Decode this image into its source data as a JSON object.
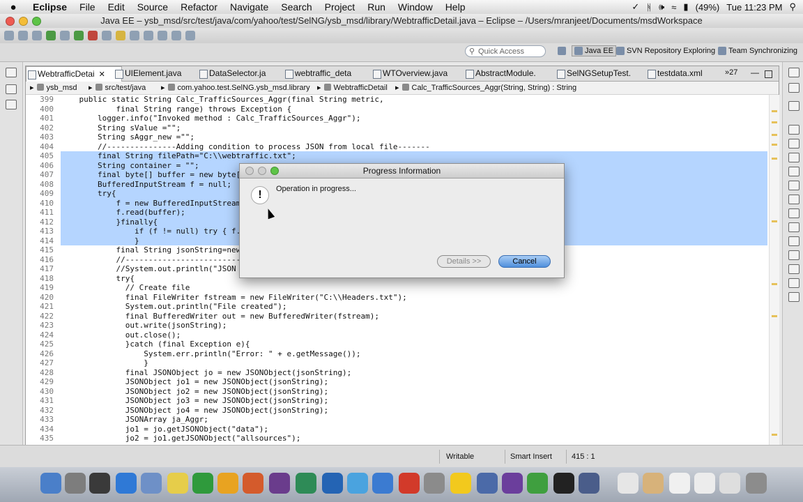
{
  "menubar": {
    "apple": "",
    "app": "Eclipse",
    "items": [
      "File",
      "Edit",
      "Source",
      "Refactor",
      "Navigate",
      "Search",
      "Project",
      "Run",
      "Window",
      "Help"
    ],
    "battery": "(49%)",
    "clock": "Tue 11:23 PM"
  },
  "window": {
    "title": "Java EE – ysb_msd/src/test/java/com/yahoo/test/SelNG/ysb_msd/library/WebtrafficDetail.java – Eclipse – /Users/mranjeet/Documents/msdWorkspace"
  },
  "perspectives": {
    "quick_access_placeholder": "Quick Access",
    "java_ee": "Java EE",
    "svn": "SVN Repository Exploring",
    "team": "Team Synchronizing"
  },
  "tabs": [
    {
      "label": "WebtrafficDetai"
    },
    {
      "label": "UIElement.java"
    },
    {
      "label": "DataSelector.ja"
    },
    {
      "label": "webtraffic_deta"
    },
    {
      "label": "WTOverview.java"
    },
    {
      "label": "AbstractModule."
    },
    {
      "label": "SelNGSetupTest."
    },
    {
      "label": "testdata.xml"
    }
  ],
  "tabs_more": "»27",
  "breadcrumb": [
    "ysb_msd",
    "src/test/java",
    "com.yahoo.test.SelNG.ysb_msd.library",
    "WebtrafficDetail",
    "Calc_TrafficSources_Aggr(String, String) : String"
  ],
  "code": [
    {
      "n": "399",
      "t": "    public static String Calc_TrafficSources_Aggr(final String metric,"
    },
    {
      "n": "400",
      "t": "            final String range) throws Exception {"
    },
    {
      "n": "401",
      "t": "        logger.info(\"Invoked method : Calc_TrafficSources_Aggr\");"
    },
    {
      "n": "402",
      "t": "        String sValue =\"\";"
    },
    {
      "n": "403",
      "t": "        String sAggr_new =\"\";"
    },
    {
      "n": "404",
      "t": "        //---------------Adding condition to process JSON from local file-------"
    },
    {
      "n": "405",
      "t": "        final String filePath=\"C:\\\\webtraffic.txt\";"
    },
    {
      "n": "406",
      "t": "        String container = \"\";"
    },
    {
      "n": "407",
      "t": "        final byte[] buffer = new byte[(i"
    },
    {
      "n": "408",
      "t": "        BufferedInputStream f = null;"
    },
    {
      "n": "409",
      "t": "        try{"
    },
    {
      "n": "410",
      "t": "            f = new BufferedInputStream(n"
    },
    {
      "n": "411",
      "t": "            f.read(buffer);"
    },
    {
      "n": "412",
      "t": "            }finally{"
    },
    {
      "n": "413",
      "t": "                if (f != null) try { f.cl"
    },
    {
      "n": "414",
      "t": "                }"
    },
    {
      "n": "415",
      "t": "            final String jsonString=new S"
    },
    {
      "n": "416",
      "t": "            //----------------------------"
    },
    {
      "n": "417",
      "t": "            //System.out.println(\"JSON Re"
    },
    {
      "n": "418",
      "t": "            try{"
    },
    {
      "n": "419",
      "t": "              // Create file"
    },
    {
      "n": "420",
      "t": "              final FileWriter fstream = new FileWriter(\"C:\\\\Headers.txt\");"
    },
    {
      "n": "421",
      "t": "              System.out.println(\"File created\");"
    },
    {
      "n": "422",
      "t": "              final BufferedWriter out = new BufferedWriter(fstream);"
    },
    {
      "n": "423",
      "t": "              out.write(jsonString);"
    },
    {
      "n": "424",
      "t": "              out.close();"
    },
    {
      "n": "425",
      "t": "              }catch (final Exception e){"
    },
    {
      "n": "426",
      "t": "                  System.err.println(\"Error: \" + e.getMessage());"
    },
    {
      "n": "427",
      "t": "                  }"
    },
    {
      "n": "428",
      "t": "              final JSONObject jo = new JSONObject(jsonString);"
    },
    {
      "n": "429",
      "t": "              JSONObject jo1 = new JSONObject(jsonString);"
    },
    {
      "n": "430",
      "t": "              JSONObject jo2 = new JSONObject(jsonString);"
    },
    {
      "n": "431",
      "t": "              JSONObject jo3 = new JSONObject(jsonString);"
    },
    {
      "n": "432",
      "t": "              JSONObject jo4 = new JSONObject(jsonString);"
    },
    {
      "n": "433",
      "t": "              JSONArray ja_Aggr;"
    },
    {
      "n": "434",
      "t": "              jo1 = jo.getJSONObject(\"data\");"
    },
    {
      "n": "435",
      "t": "              jo2 = jo1.getJSONObject(\"allsources\");"
    }
  ],
  "status": {
    "writable": "Writable",
    "insert_mode": "Smart Insert",
    "position": "415 : 1"
  },
  "dialog": {
    "title": "Progress Information",
    "message": "Operation in progress...",
    "details_label": "Details >>",
    "cancel_label": "Cancel"
  },
  "colors": {
    "selection": "#b5d5ff",
    "cancel_button": "#4f8fdc"
  }
}
